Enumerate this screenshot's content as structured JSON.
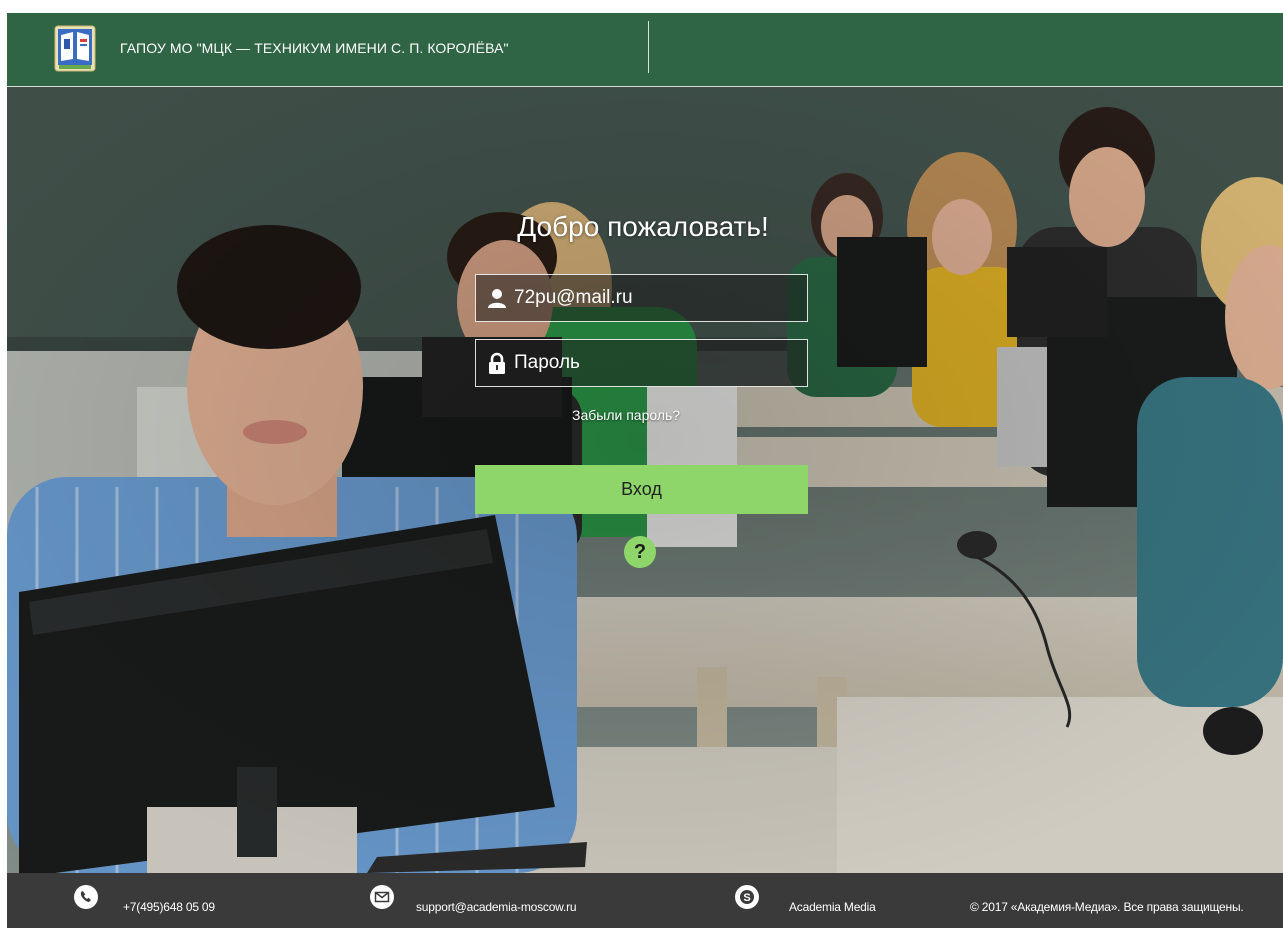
{
  "header": {
    "org_name": "ГАПОУ МО \"МЦК — ТЕХНИКУМ ИМЕНИ С. П. КОРОЛЁВА\""
  },
  "login": {
    "welcome": "Добро пожаловать!",
    "email_value": "72pu@mail.ru",
    "password_placeholder": "Пароль",
    "forgot_link": "Забыли пароль?",
    "submit_label": "Вход",
    "help_label": "?"
  },
  "footer": {
    "phone": "+7(495)648 05 09",
    "email": "support@academia-moscow.ru",
    "skype": "Academia Media",
    "copyright": "© 2017 «Академия-Медиа». Все права защищены."
  },
  "icons": {
    "user": "user-icon",
    "lock": "lock-icon",
    "phone": "phone-icon",
    "mail": "mail-icon",
    "skype": "skype-icon"
  },
  "colors": {
    "header_bg": "#2f6544",
    "accent_green": "#8ed66a",
    "footer_bg": "#3a3a3a"
  }
}
